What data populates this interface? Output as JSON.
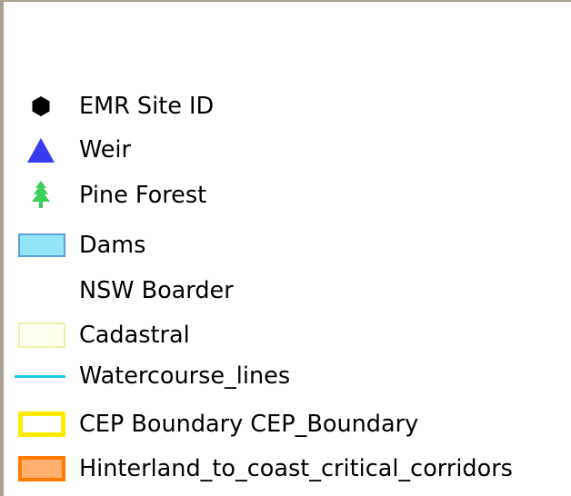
{
  "legend": {
    "items": [
      {
        "label": "EMR Site ID",
        "symbol": "hexagon-icon",
        "color": "#000000"
      },
      {
        "label": "Weir",
        "symbol": "triangle-icon",
        "color": "#3a3af0"
      },
      {
        "label": "Pine Forest",
        "symbol": "pine-tree-icon",
        "color": "#3dcf5a"
      },
      {
        "label": "Dams",
        "symbol": "polygon-fill",
        "fill": "#92e4f7",
        "stroke": "#5a9de0"
      },
      {
        "label": "NSW Boarder",
        "symbol": "none"
      },
      {
        "label": "Cadastral",
        "symbol": "polygon-outline",
        "fill": "#fffff2",
        "stroke": "#f0f0a8"
      },
      {
        "label": "Watercourse_lines",
        "symbol": "line",
        "color": "#22c8e8"
      },
      {
        "label": "CEP Boundary CEP_Boundary",
        "symbol": "polygon-outline",
        "fill": "#ffffff",
        "stroke": "#ffea00"
      },
      {
        "label": "Hinterland_to_coast_critical_corridors",
        "symbol": "polygon-fill",
        "fill": "#ffb070",
        "stroke": "#ff7a00"
      }
    ]
  }
}
